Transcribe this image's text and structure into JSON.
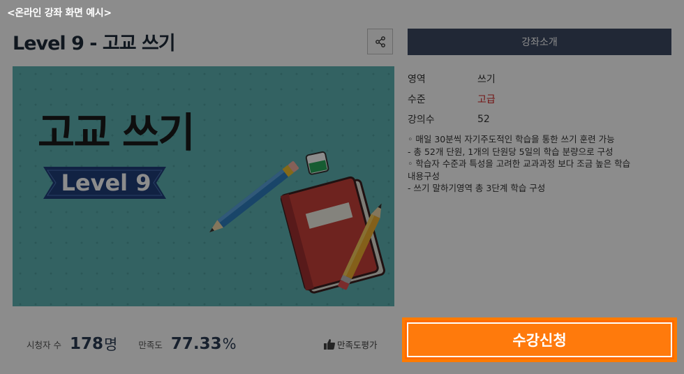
{
  "caption": "<온라인 강좌 화면 예시>",
  "course": {
    "title": "Level 9 - 고교 쓰기"
  },
  "thumbnail": {
    "title": "고교 쓰기",
    "ribbon": "Level 9"
  },
  "tabs": {
    "intro": "강좌소개"
  },
  "info": [
    {
      "label": "영역",
      "value": "쓰기"
    },
    {
      "label": "수준",
      "value": "고급"
    },
    {
      "label": "강의수",
      "value": "52"
    }
  ],
  "description": [
    "◦ 매일 30분씩 자기주도적인 학습을 통한 쓰기 훈련 가능",
    "- 총 52개 단원, 1개의 단원당 5일의 학습 분량으로 구성",
    "◦ 학습자 수준과 특성을 고려한 교과과정 보다 조금 높은 학습",
    "내용구성",
    "- 쓰기 말하기영역 총 3단계 학습 구성"
  ],
  "stats": {
    "viewers_label": "시청자 수",
    "viewers_value": "178",
    "viewers_unit": "명",
    "satisfaction_label": "만족도",
    "satisfaction_value": "77.33",
    "satisfaction_unit": "%"
  },
  "rate_label": "만족도평가",
  "enroll_label": "수강신청",
  "colors": {
    "accent": "#ff7a0c",
    "navy": "#3d4a63",
    "level_red": "#d12424",
    "thumb_bg": "#5db3b3"
  },
  "icons": {
    "share": "share-icon",
    "thumbs_up": "thumbs-up-icon"
  }
}
